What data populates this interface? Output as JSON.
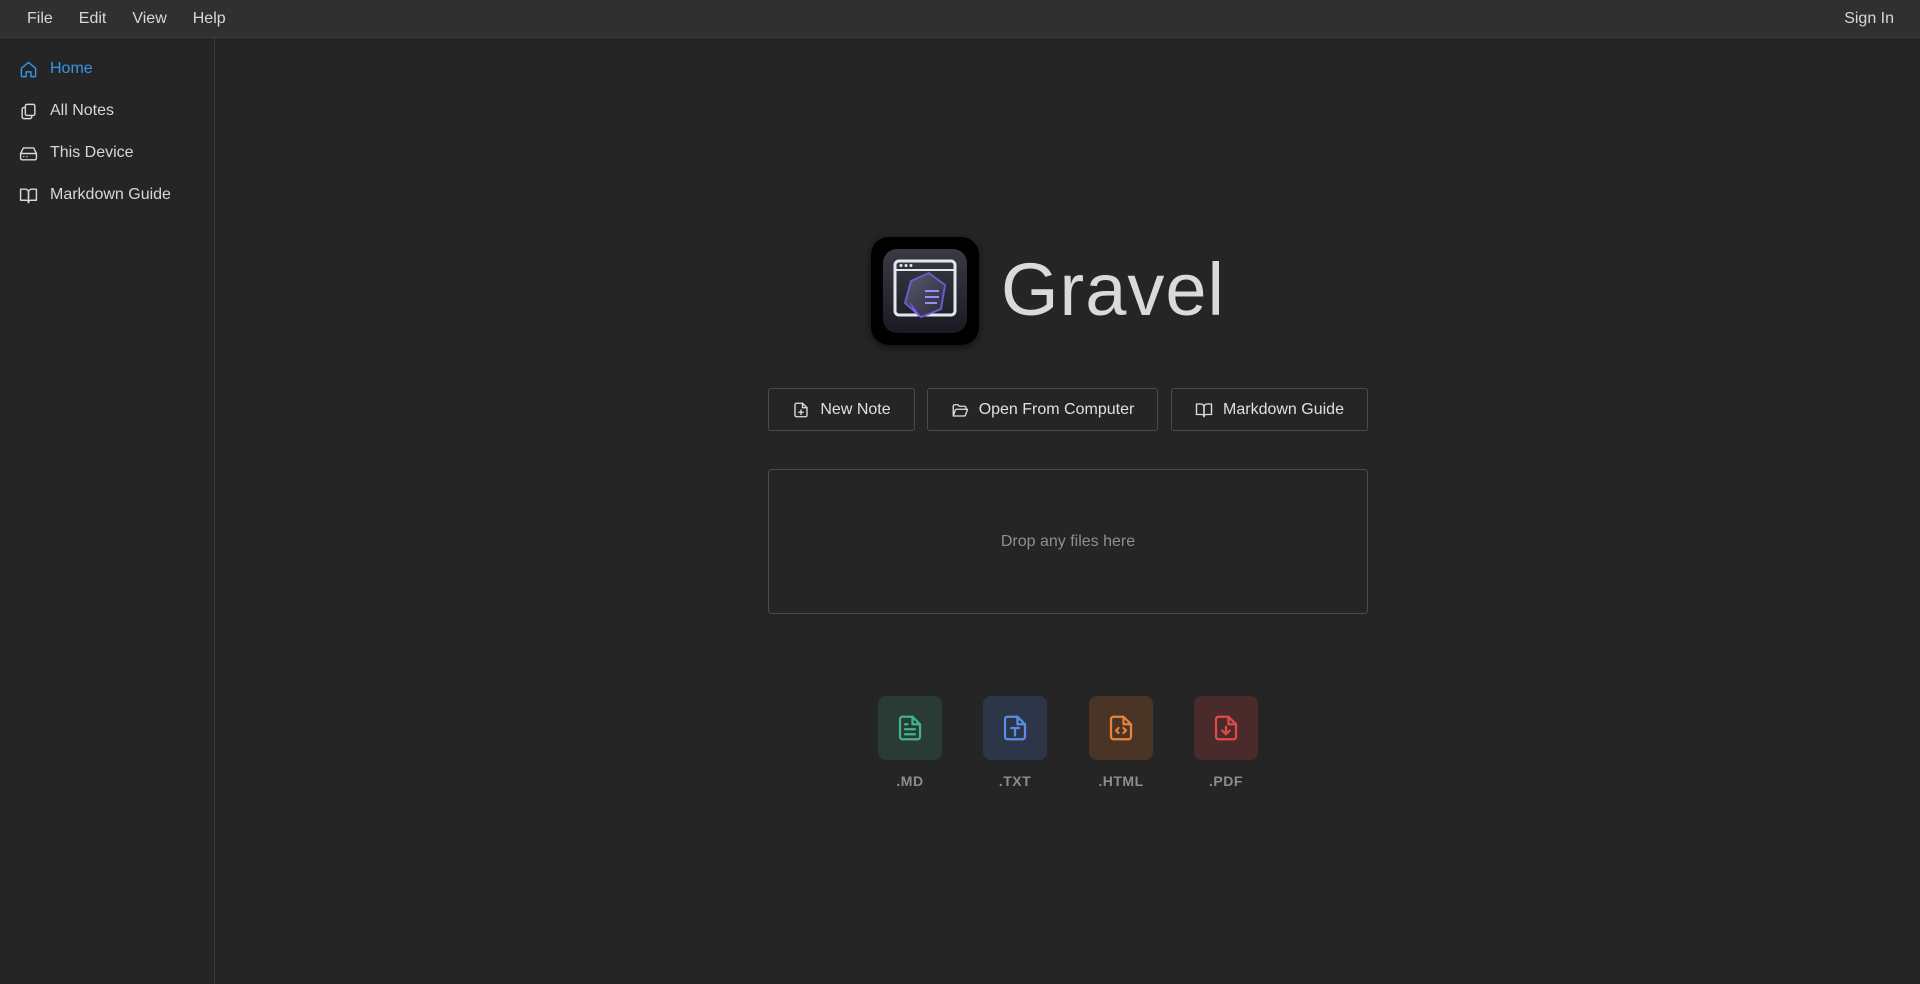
{
  "menubar": {
    "items": [
      "File",
      "Edit",
      "View",
      "Help"
    ],
    "sign_in": "Sign In"
  },
  "sidebar": {
    "items": [
      {
        "label": "Home",
        "icon": "home-icon",
        "active": true
      },
      {
        "label": "All Notes",
        "icon": "notes-icon",
        "active": false
      },
      {
        "label": "This Device",
        "icon": "hard-drive-icon",
        "active": false
      },
      {
        "label": "Markdown Guide",
        "icon": "book-open-icon",
        "active": false
      }
    ]
  },
  "main": {
    "app_name": "Gravel",
    "buttons": {
      "new_note": "New Note",
      "open_from_computer": "Open From Computer",
      "markdown_guide": "Markdown Guide"
    },
    "dropzone_text": "Drop any files here",
    "file_types": [
      {
        "label": ".MD",
        "icon": "file-text-icon",
        "color": "#3fb58c",
        "bg": "#2a3b36"
      },
      {
        "label": ".TXT",
        "icon": "file-type-icon",
        "color": "#5b8de8",
        "bg": "#2d3648"
      },
      {
        "label": ".HTML",
        "icon": "file-code-icon",
        "color": "#e8843a",
        "bg": "#4a3426"
      },
      {
        "label": ".PDF",
        "icon": "file-download-icon",
        "color": "#e04a4a",
        "bg": "#4a2a2a"
      }
    ]
  },
  "colors": {
    "accent": "#3794e6",
    "background": "#252525",
    "menubar": "#303030"
  }
}
